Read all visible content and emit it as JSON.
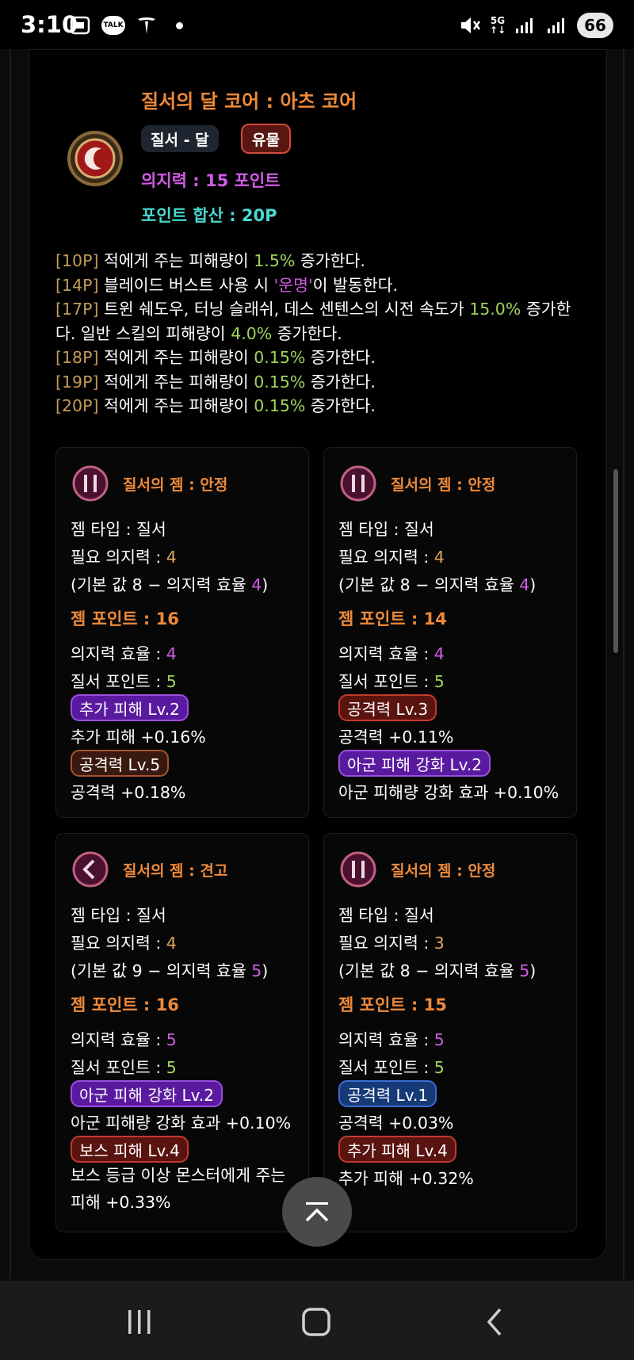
{
  "status_bar": {
    "time": "3:10",
    "talk_label": "TALK",
    "network": "5G",
    "battery": "66",
    "icons": [
      "gallery-icon",
      "kakaotalk-icon",
      "tesla-icon",
      "dot-icon",
      "mute-icon",
      "5g-icon",
      "signal-icon",
      "signal-icon",
      "battery-icon"
    ]
  },
  "core": {
    "title": "질서의 달 코어 : 아츠 코어",
    "tag_type": "질서 - 달",
    "tag_grade": "유물",
    "willpower": "의지력 : 15 포인트",
    "point_sum": "포인트 합산 : 20P",
    "effects": [
      {
        "p": "[10P]",
        "a": " 적에게 주는 피해량이 ",
        "h": "1.5%",
        "b": " 증가한다."
      },
      {
        "p": "[14P]",
        "a": " 블레이드 버스트 사용 시 ",
        "h": "'운명'",
        "b": "이 발동한다."
      },
      {
        "p": "[17P]",
        "a": " 트윈 쉐도우, 터닝 슬래쉬, 데스 센텐스의 시전 속도가 ",
        "h": "15.0%",
        "b": " 증가한다. 일반 스킬의 피해량이 ",
        "h2": "4.0%",
        "c": " 증가한다."
      },
      {
        "p": "[18P]",
        "a": " 적에게 주는 피해량이 ",
        "h": "0.15%",
        "b": " 증가한다."
      },
      {
        "p": "[19P]",
        "a": " 적에게 주는 피해량이 ",
        "h": "0.15%",
        "b": " 증가한다."
      },
      {
        "p": "[20P]",
        "a": " 적에게 주는 피해량이 ",
        "h": "0.15%",
        "b": " 증가한다."
      }
    ]
  },
  "labels": {
    "gem_type": "젬 타입 : ",
    "required_will": "필요 의지력 : ",
    "base_open": "(기본 값 ",
    "base_mid": " − 의지력 효율 ",
    "base_close": ")",
    "gem_points": "젬 포인트 : ",
    "will_eff": "의지력 효율 : ",
    "order_points": "질서 포인트 : "
  },
  "gems": [
    {
      "name": "질서의 젬 : 안정",
      "type": "질서",
      "required": "4",
      "base": "8",
      "eff": "4",
      "points": "16",
      "order_points": "5",
      "opt1_badge": "추가 피해 Lv.2",
      "opt1_desc": "추가 피해 +0.16%",
      "opt2_badge": "공격력 Lv.5",
      "opt2_desc": "공격력 +0.18%"
    },
    {
      "name": "질서의 젬 : 안정",
      "type": "질서",
      "required": "4",
      "base": "8",
      "eff": "4",
      "points": "14",
      "order_points": "5",
      "opt1_badge": "공격력 Lv.3",
      "opt1_desc": "공격력 +0.11%",
      "opt2_badge": "아군 피해 강화 Lv.2",
      "opt2_desc": "아군 피해량 강화 효과 +0.10%"
    },
    {
      "name": "질서의 젬 : 견고",
      "type": "질서",
      "required": "4",
      "base": "9",
      "eff": "5",
      "points": "16",
      "order_points": "5",
      "opt1_badge": "아군 피해 강화 Lv.2",
      "opt1_desc": "아군 피해량 강화 효과 +0.10%",
      "opt2_badge": "보스 피해 Lv.4",
      "opt2_desc": "보스 등급 이상 몬스터에게 주는 피해 +0.33%"
    },
    {
      "name": "질서의 젬 : 안정",
      "type": "질서",
      "required": "3",
      "base": "8",
      "eff": "5",
      "points": "15",
      "order_points": "5",
      "opt1_badge": "공격력 Lv.1",
      "opt1_desc": "공격력 +0.03%",
      "opt2_badge": "추가 피해 Lv.4",
      "opt2_desc": "추가 피해 +0.32%"
    }
  ],
  "colors": {
    "accent_orange": "#ee8a3a",
    "purple": "#d25be6",
    "teal": "#49d8cf",
    "green": "#9dd45a"
  }
}
